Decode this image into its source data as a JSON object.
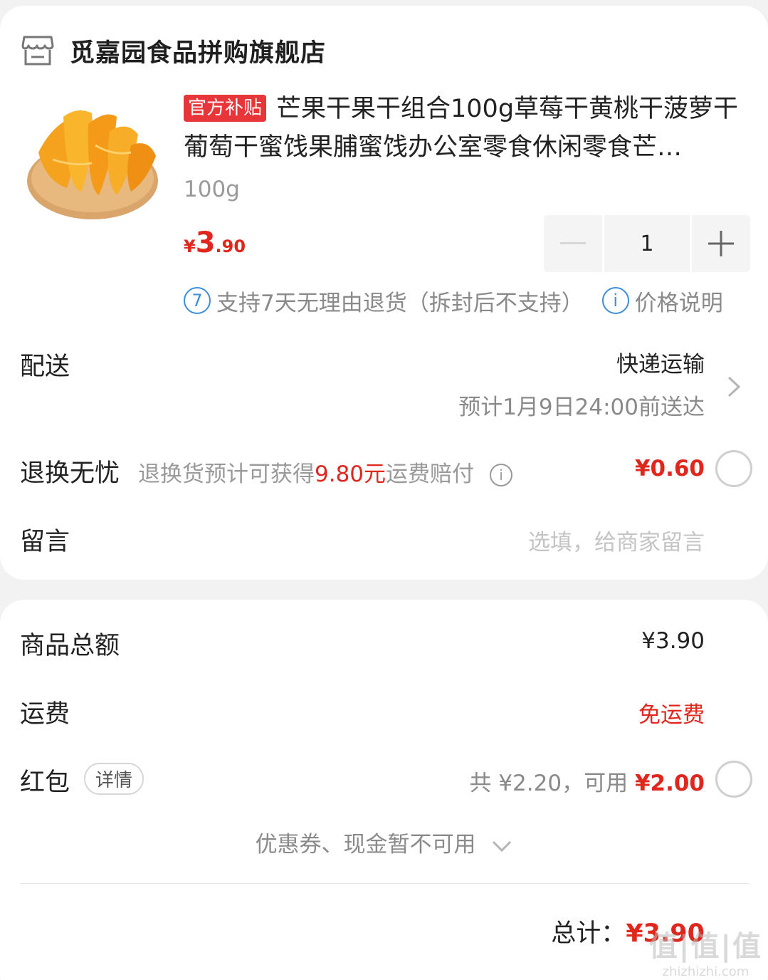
{
  "shop": {
    "icon": "store-icon",
    "name": "觅嘉园食品拼购旗舰店"
  },
  "product": {
    "image": "dried-mango-image",
    "tag": "官方补贴",
    "title": "芒果干果干组合100g草莓干黄桃干菠萝干葡萄干蜜饯果脯蜜饯办公室零食休闲零食芒…",
    "sku": "100g",
    "price_currency": "¥",
    "price_int": "3",
    "price_dec": ".90",
    "quantity": "1",
    "policy_icon_text": "7",
    "policy_text": "支持7天无理由退货（拆封后不支持）",
    "price_info_icon_text": "i",
    "price_info_text": "价格说明"
  },
  "delivery": {
    "label": "配送",
    "method": "快递运输",
    "eta": "预计1月9日24:00前送达"
  },
  "return_insurance": {
    "label": "退换无忧",
    "desc_prefix": "退换货预计可获得",
    "desc_amount": "9.80元",
    "desc_suffix": "运费赔付",
    "info_icon_text": "i",
    "price": "¥0.60"
  },
  "message": {
    "label": "留言",
    "placeholder": "选填，给商家留言"
  },
  "summary": {
    "goods_total_label": "商品总额",
    "goods_total_value": "¥3.90",
    "shipping_label": "运费",
    "shipping_value": "免运费",
    "redpacket_label": "红包",
    "redpacket_detail": "详情",
    "redpacket_total": "共 ¥2.20，可用 ",
    "redpacket_usable": "¥2.00",
    "coupon_text": "优惠券、现金暂不可用",
    "total_label": "总计：",
    "total_value": "¥3.90"
  },
  "watermark": {
    "main": "值|值|值",
    "sub": "zhizhizhi.com"
  },
  "colors": {
    "accent_red": "#e0261d",
    "info_blue": "#3d8ed9",
    "muted_gray": "#9a9a9a",
    "background": "#f2f2f2"
  }
}
